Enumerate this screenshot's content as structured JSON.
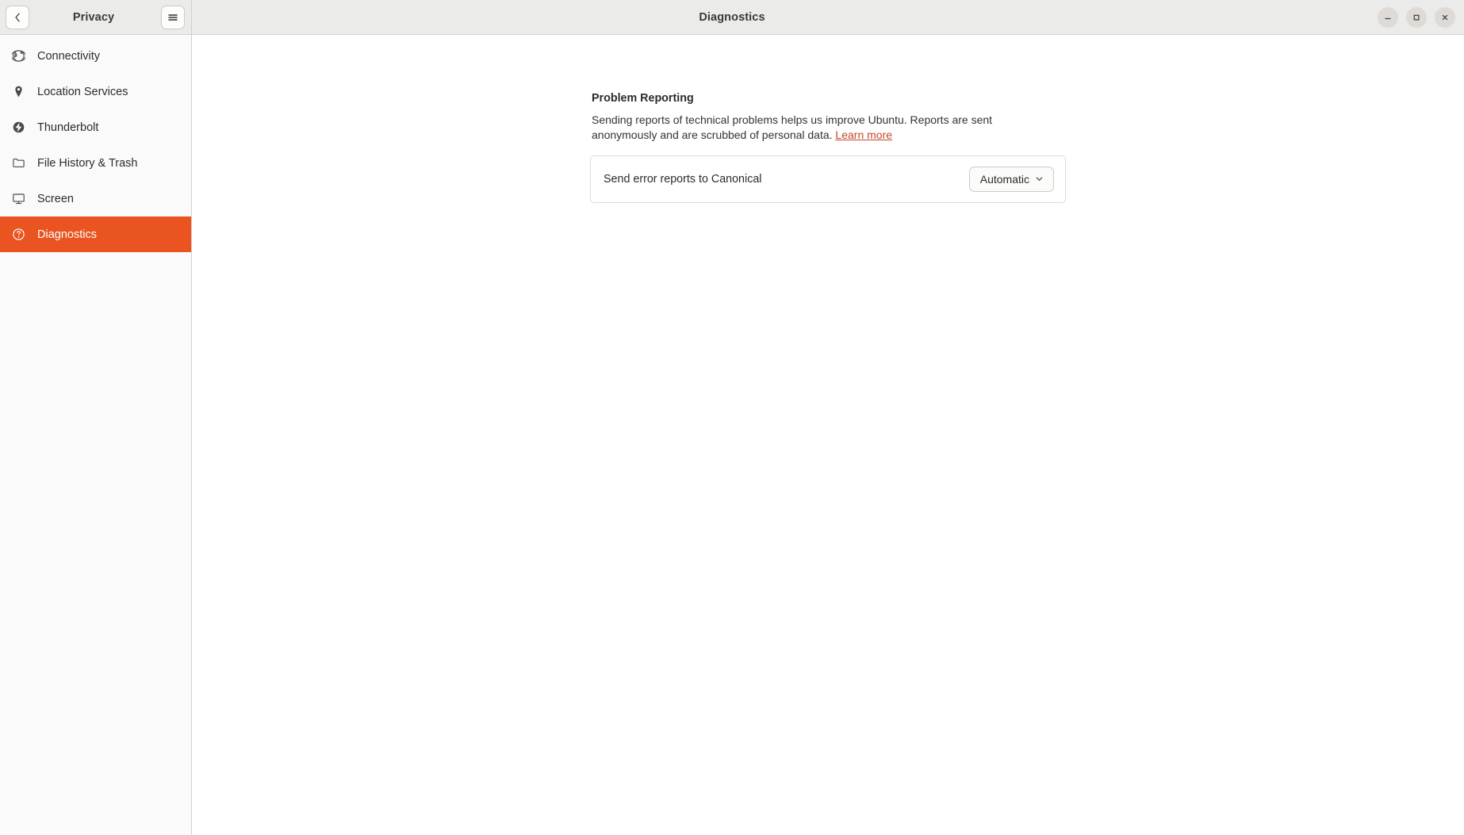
{
  "window": {
    "header_left_title": "Privacy",
    "header_center_title": "Diagnostics",
    "back_icon": "chevron-left-icon",
    "menu_icon": "hamburger-menu-icon",
    "controls": {
      "minimize": "minimize-icon",
      "maximize": "maximize-icon",
      "close": "close-icon"
    }
  },
  "sidebar": {
    "items": [
      {
        "label": "Connectivity",
        "icon": "globe-icon",
        "selected": false
      },
      {
        "label": "Location Services",
        "icon": "location-pin-icon",
        "selected": false
      },
      {
        "label": "Thunderbolt",
        "icon": "thunderbolt-icon",
        "selected": false
      },
      {
        "label": "File History & Trash",
        "icon": "folder-icon",
        "selected": false
      },
      {
        "label": "Screen",
        "icon": "monitor-icon",
        "selected": false
      },
      {
        "label": "Diagnostics",
        "icon": "question-circle-icon",
        "selected": true
      }
    ]
  },
  "main": {
    "section_title": "Problem Reporting",
    "description": "Sending reports of technical problems helps us improve Ubuntu. Reports are sent anonymously and are scrubbed of personal data.",
    "learn_more": "Learn more",
    "row": {
      "label": "Send error reports to Canonical",
      "dropdown_value": "Automatic",
      "dropdown_icon": "chevron-down-icon"
    }
  },
  "colors": {
    "accent": "#e95420",
    "link": "#c7472a",
    "header_bg": "#ebebe9",
    "sidebar_bg": "#fafafa"
  }
}
